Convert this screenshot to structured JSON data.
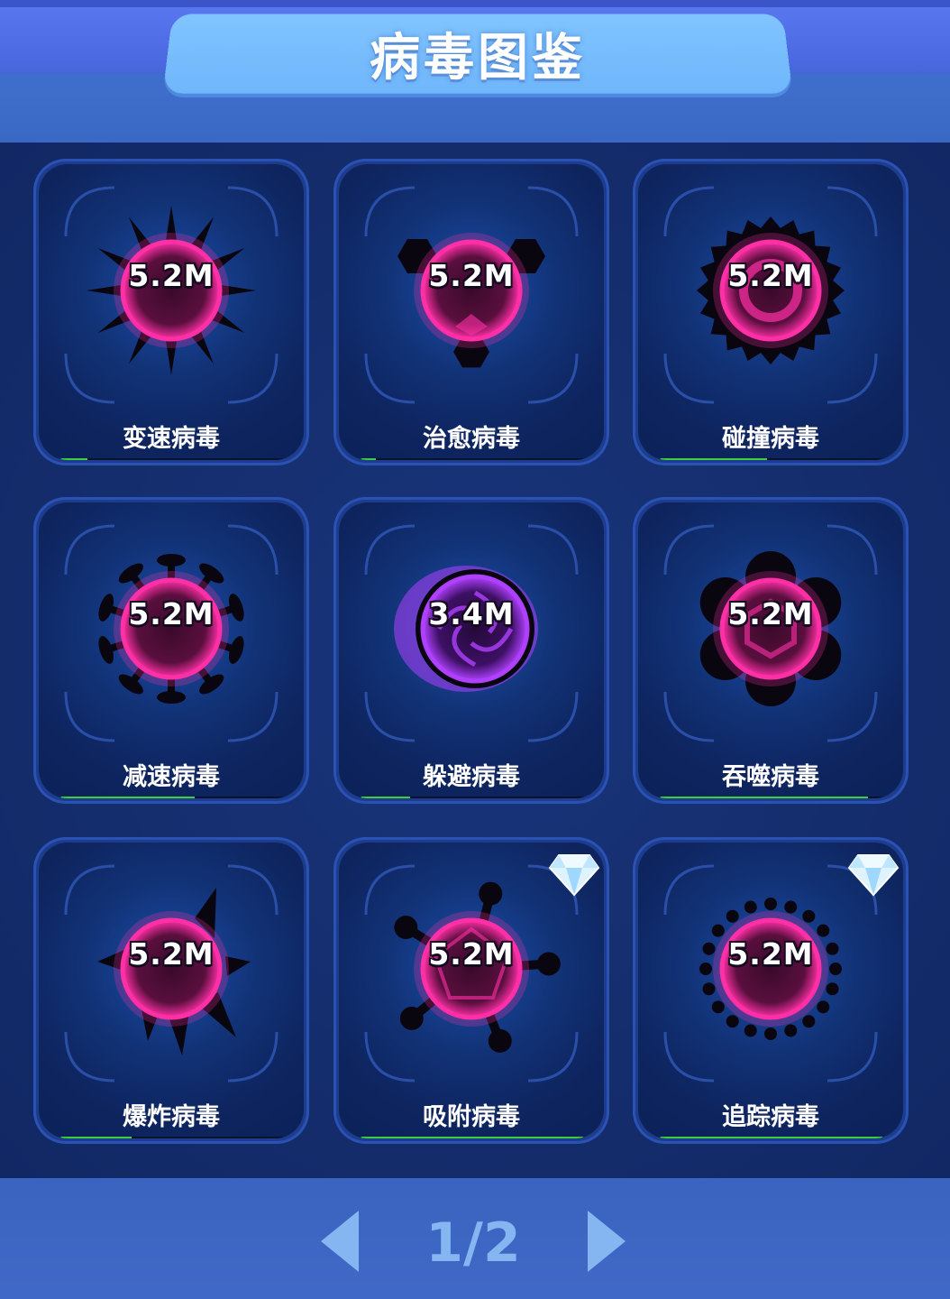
{
  "header": {
    "title": "病毒图鉴"
  },
  "viruses": [
    {
      "name": "变速病毒",
      "value": "5.2M",
      "progress": 0.12,
      "icon": "spiked-virus-icon",
      "gem": false
    },
    {
      "name": "治愈病毒",
      "value": "5.2M",
      "progress": 0.07,
      "icon": "hexagon-virus-icon",
      "gem": false
    },
    {
      "name": "碰撞病毒",
      "value": "5.2M",
      "progress": 0.48,
      "icon": "gear-virus-icon",
      "gem": false
    },
    {
      "name": "减速病毒",
      "value": "5.2M",
      "progress": 0.6,
      "icon": "corona-virus-icon",
      "gem": false
    },
    {
      "name": "躲避病毒",
      "value": "3.4M",
      "progress": 0.22,
      "icon": "swirl-virus-icon",
      "gem": false
    },
    {
      "name": "吞噬病毒",
      "value": "5.2M",
      "progress": 0.93,
      "icon": "flower-virus-icon",
      "gem": false
    },
    {
      "name": "爆炸病毒",
      "value": "5.2M",
      "progress": 0.32,
      "icon": "shard-virus-icon",
      "gem": false
    },
    {
      "name": "吸附病毒",
      "value": "5.2M",
      "progress": 1.0,
      "icon": "pin-virus-icon",
      "gem": true
    },
    {
      "name": "追踪病毒",
      "value": "5.2M",
      "progress": 1.0,
      "icon": "dotted-virus-icon",
      "gem": true
    }
  ],
  "pagination": {
    "indicator": "1/2",
    "prev_icon": "triangle-left-icon",
    "next_icon": "triangle-right-icon"
  },
  "colors": {
    "virus_pink": "#ff2fa6",
    "virus_purple": "#b040ff",
    "progress_green": "#3bd03b"
  }
}
